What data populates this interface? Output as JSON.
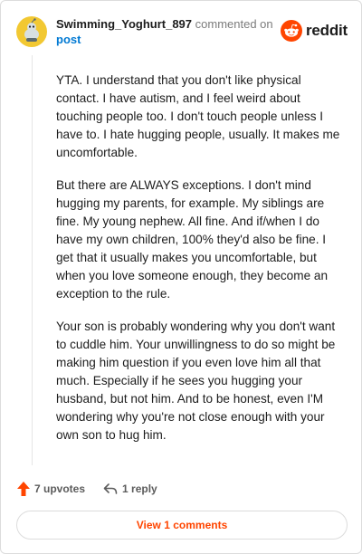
{
  "header": {
    "username": "Swimming_Yoghurt_897",
    "action_text": "commented on",
    "post_link": "post",
    "logo_text": "reddit"
  },
  "comment": {
    "paragraphs": [
      "YTA. I understand that you don't like physical contact. I have autism, and I feel weird about touching people too. I don't touch people unless I have to. I hate hugging people, usually. It makes me uncomfortable.",
      "But there are ALWAYS exceptions. I don't mind hugging my parents, for example. My siblings are fine. My young nephew. All fine. And if/when I do have my own children, 100% they'd also be fine. I get that it usually makes you uncomfortable, but when you love someone enough, they become an exception to the rule.",
      "Your son is probably wondering why you don't want to cuddle him. Your unwillingness to do so might be making him question if you even love him all that much. Especially if he sees you hugging your husband, but not him. And to be honest, even I'M wondering why you're not close enough with your own son to hug him."
    ]
  },
  "actions": {
    "upvotes": "7 upvotes",
    "replies": "1 reply",
    "upvote_icon": "upvote-arrow-icon",
    "reply_icon": "reply-arrow-icon"
  },
  "footer": {
    "view_comments": "View 1 comments"
  },
  "colors": {
    "brand": "#ff4500",
    "link": "#0079d3",
    "avatar": "#f2c832"
  }
}
